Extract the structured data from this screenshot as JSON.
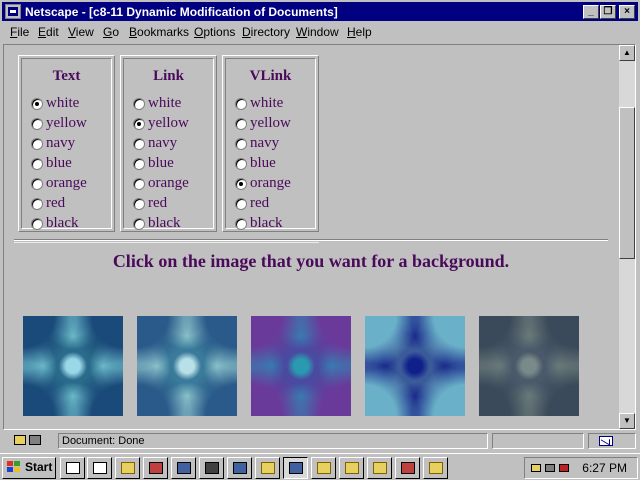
{
  "window": {
    "title": "Netscape - [c8-11 Dynamic Modification of Documents]",
    "minimize_glyph": "_",
    "restore_glyph": "❐",
    "close_glyph": "×"
  },
  "menu": [
    {
      "accel": "F",
      "rest": "ile"
    },
    {
      "accel": "E",
      "rest": "dit"
    },
    {
      "accel": "V",
      "rest": "iew"
    },
    {
      "accel": "G",
      "rest": "o"
    },
    {
      "accel": "B",
      "rest": "ookmarks"
    },
    {
      "accel": "O",
      "rest": "ptions"
    },
    {
      "accel": "D",
      "rest": "irectory"
    },
    {
      "accel": "W",
      "rest": "indow"
    },
    {
      "accel": "H",
      "rest": "elp"
    }
  ],
  "color_tables": [
    {
      "heading": "Text",
      "options": [
        "white",
        "yellow",
        "navy",
        "blue",
        "orange",
        "red",
        "black"
      ],
      "selected": "white"
    },
    {
      "heading": "Link",
      "options": [
        "white",
        "yellow",
        "navy",
        "blue",
        "orange",
        "red",
        "black"
      ],
      "selected": "yellow"
    },
    {
      "heading": "VLink",
      "options": [
        "white",
        "yellow",
        "navy",
        "blue",
        "orange",
        "red",
        "black"
      ],
      "selected": "orange"
    }
  ],
  "prompt": "Click on the image that you want for a background.",
  "background_images": [
    {
      "c0": "#2a6a8a",
      "c1": "#9ad8e8",
      "c2": "#1a4a7a",
      "c3": "#6ab8c8"
    },
    {
      "c0": "#3a7a9a",
      "c1": "#b8e0e8",
      "c2": "#2a5a8a",
      "c3": "#88c0c8"
    },
    {
      "c0": "#4a4aa0",
      "c1": "#2a9ab0",
      "c2": "#6a3a9a",
      "c3": "#3a7ab0"
    },
    {
      "c0": "#3a5a9a",
      "c1": "#10208a",
      "c2": "#6ab0c8",
      "c3": "#1a2a8a"
    },
    {
      "c0": "#4a5a6a",
      "c1": "#7a8a8a",
      "c2": "#3a4a5a",
      "c3": "#6a7a7a"
    }
  ],
  "status": {
    "text": "Document: Done"
  },
  "scrollbar": {
    "up_glyph": "▲",
    "down_glyph": "▼"
  },
  "taskbar": {
    "start_label": "Start",
    "clock": "6:27 PM",
    "buttons": [
      {
        "name": "task-notepad-1",
        "icon": "doc",
        "active": false
      },
      {
        "name": "task-notepad-2",
        "icon": "doc",
        "active": false
      },
      {
        "name": "task-folder-1",
        "icon": "folder",
        "active": false
      },
      {
        "name": "task-document",
        "icon": "red",
        "active": false
      },
      {
        "name": "task-control-panel",
        "icon": "blue",
        "active": false
      },
      {
        "name": "task-tool",
        "icon": "dark",
        "active": false
      },
      {
        "name": "task-paint",
        "icon": "blue",
        "active": false
      },
      {
        "name": "task-folder-2",
        "icon": "folder",
        "active": false
      },
      {
        "name": "task-netscape",
        "icon": "blue",
        "active": true
      },
      {
        "name": "task-folder-3",
        "icon": "folder",
        "active": false
      },
      {
        "name": "task-folder-4",
        "icon": "folder",
        "active": false
      },
      {
        "name": "task-folder-5",
        "icon": "folder",
        "active": false
      },
      {
        "name": "task-wordpad",
        "icon": "red",
        "active": false
      },
      {
        "name": "task-folder-6",
        "icon": "folder",
        "active": false
      }
    ]
  }
}
